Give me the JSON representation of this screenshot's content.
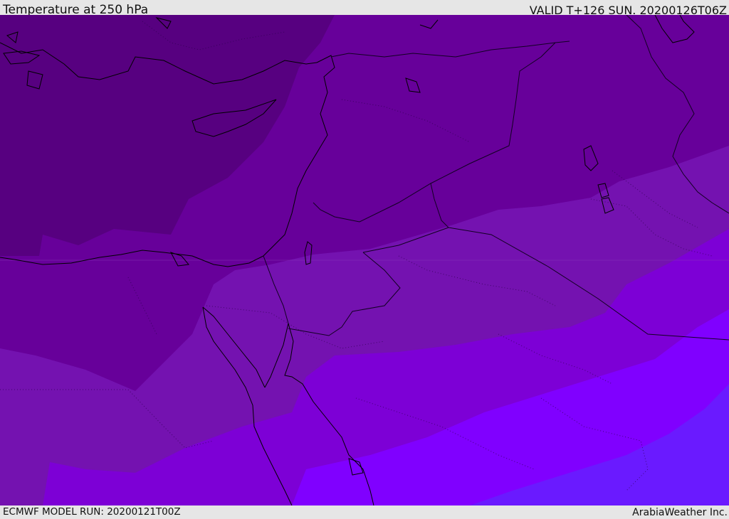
{
  "header": {
    "title": "Temperature at 250 hPa",
    "valid": "VALID T+126 SUN. 20200126T06Z"
  },
  "footer": {
    "model_run": "ECMWF MODEL RUN: 20200121T00Z",
    "credit": "ArabiaWeather Inc."
  },
  "map": {
    "field": "Temperature at 250 hPa",
    "colors": {
      "band_1": "#570080",
      "band_2": "#67009a",
      "band_3": "#7412b0",
      "band_4": "#7d00d6",
      "band_5": "#8000ff",
      "band_6": "#6a1aff",
      "coastline": "#000000",
      "border": "#1a0033"
    }
  }
}
